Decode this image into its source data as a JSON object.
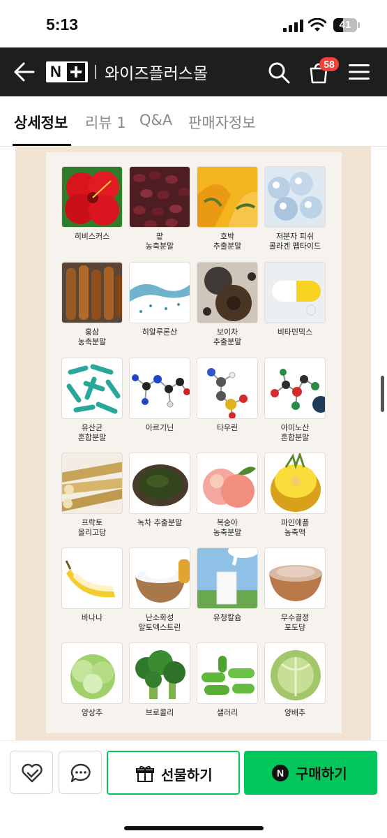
{
  "status": {
    "time": "5:13",
    "battery": "41",
    "battery_level": 0.41
  },
  "header": {
    "brand_icon": "naver-plus-logo",
    "store_name": "와이즈플러스몰",
    "cart_count": "58",
    "colors": {
      "bar": "#1e1e1e",
      "badge": "#f04438"
    }
  },
  "tabs": [
    {
      "label": "상세정보",
      "active": true
    },
    {
      "label": "리뷰 1",
      "active": false
    },
    {
      "label": "Q&A",
      "active": false
    },
    {
      "label": "판매자정보",
      "active": false
    }
  ],
  "ingredients": [
    {
      "label": "히비스커스",
      "icon": "hibiscus-image"
    },
    {
      "label": "팥\n농축분말",
      "icon": "red-bean-image"
    },
    {
      "label": "호박\n추출분말",
      "icon": "pumpkin-image"
    },
    {
      "label": "저분자 피쉬\n콜라겐 펩타이드",
      "icon": "collagen-image"
    },
    {
      "label": "홍삼\n농축분말",
      "icon": "red-ginseng-image"
    },
    {
      "label": "히알루론산",
      "icon": "hyaluronic-acid-image"
    },
    {
      "label": "보이차\n추출분말",
      "icon": "puer-tea-image"
    },
    {
      "label": "비타민믹스",
      "icon": "vitamin-capsule-image"
    },
    {
      "label": "유산균\n혼합분말",
      "icon": "lactobacillus-image"
    },
    {
      "label": "아르기닌",
      "icon": "arginine-molecule-image"
    },
    {
      "label": "타우린",
      "icon": "taurine-molecule-image"
    },
    {
      "label": "아미노산\n혼합분말",
      "icon": "amino-acid-molecule-image"
    },
    {
      "label": "프락토\n올리고당",
      "icon": "sugarcane-image"
    },
    {
      "label": "녹차 추출분말",
      "icon": "green-tea-powder-image"
    },
    {
      "label": "복숭아\n농축분말",
      "icon": "peach-image"
    },
    {
      "label": "파인애플\n농축액",
      "icon": "pineapple-image"
    },
    {
      "label": "바나나",
      "icon": "banana-image"
    },
    {
      "label": "난소화성\n말토덱스트린",
      "icon": "maltodextrin-image"
    },
    {
      "label": "유청칼슘",
      "icon": "milk-image"
    },
    {
      "label": "무수결정\n포도당",
      "icon": "glucose-powder-image"
    },
    {
      "label": "양상추",
      "icon": "lettuce-image"
    },
    {
      "label": "브로콜리",
      "icon": "broccoli-image"
    },
    {
      "label": "샐러리",
      "icon": "celery-image"
    },
    {
      "label": "양배추",
      "icon": "cabbage-image"
    }
  ],
  "bottom_bar": {
    "gift_label": "선물하기",
    "buy_label": "구매하기",
    "buy_logo": "N",
    "accent_color": "#03c75a"
  }
}
